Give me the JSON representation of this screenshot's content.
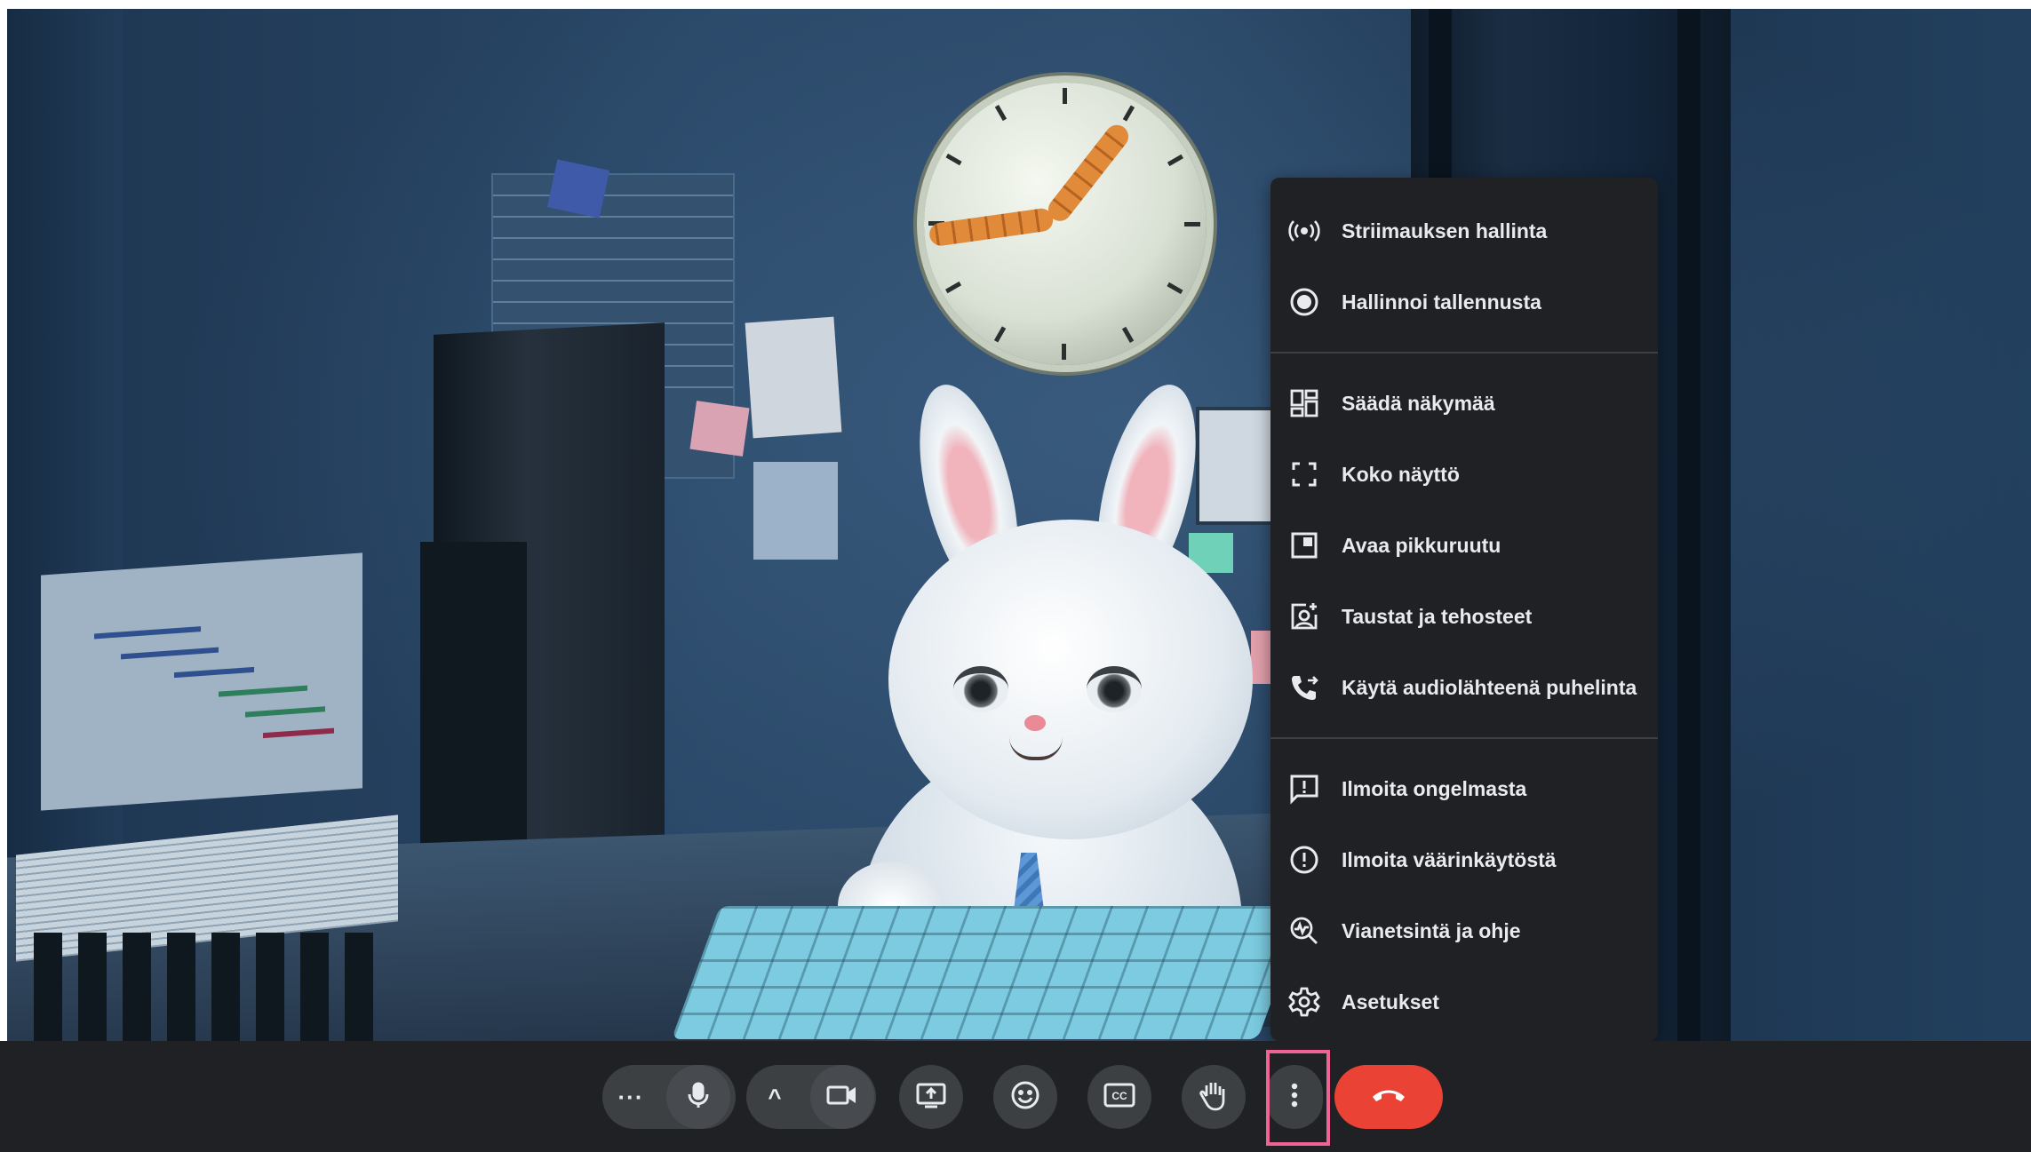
{
  "menu": {
    "items": [
      {
        "label": "Striimauksen hallinta",
        "icon": "live-stream-icon"
      },
      {
        "label": "Hallinnoi tallennusta",
        "icon": "record-icon"
      },
      {
        "label": "Säädä näkymää",
        "icon": "layout-icon"
      },
      {
        "label": "Koko näyttö",
        "icon": "fullscreen-icon"
      },
      {
        "label": "Avaa pikkuruutu",
        "icon": "picture-in-picture-icon"
      },
      {
        "label": "Taustat ja tehosteet",
        "icon": "backgrounds-effects-icon"
      },
      {
        "label": "Käytä audiolähteenä puhelinta",
        "icon": "phone-audio-icon"
      },
      {
        "label": "Ilmoita ongelmasta",
        "icon": "report-problem-icon"
      },
      {
        "label": "Ilmoita väärinkäytöstä",
        "icon": "report-abuse-icon"
      },
      {
        "label": "Vianetsintä ja ohje",
        "icon": "troubleshooting-icon"
      },
      {
        "label": "Asetukset",
        "icon": "settings-icon"
      }
    ]
  },
  "controls": {
    "audio_options_label": "···",
    "video_options_label": "^",
    "buttons": [
      "microphone",
      "camera",
      "present-screen",
      "emoji-reactions",
      "captions",
      "raise-hand",
      "more-options",
      "leave-call"
    ],
    "highlighted": "more-options"
  },
  "colors": {
    "menu_bg": "#202124",
    "bar_bg": "#202124",
    "button_bg": "#3c4043",
    "hangup": "#ea4335",
    "highlight": "#f06292"
  }
}
